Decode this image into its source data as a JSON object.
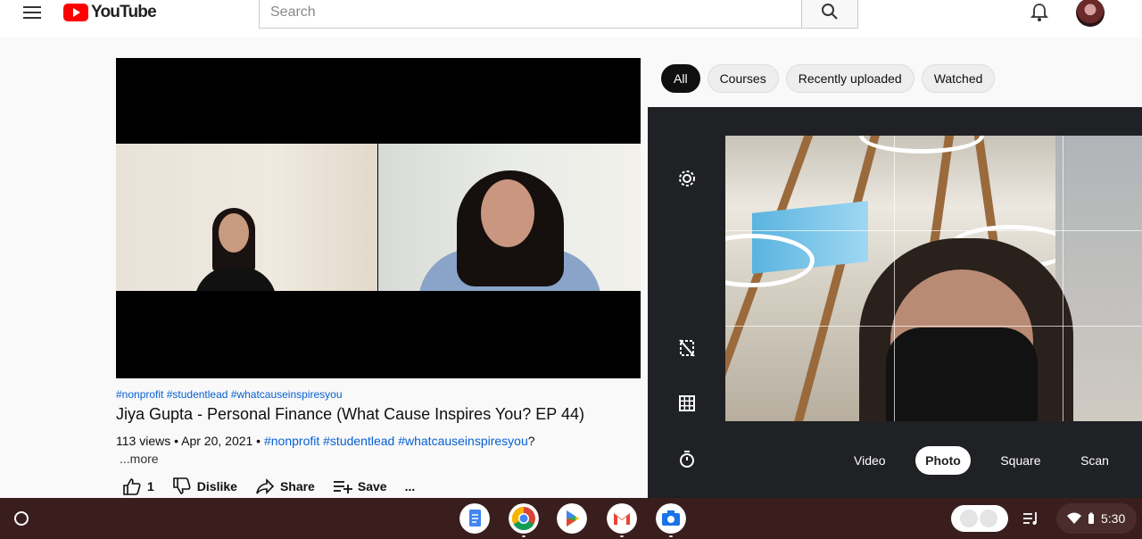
{
  "header": {
    "logo_text": "YouTube",
    "search_placeholder": "Search"
  },
  "video": {
    "tags": "#nonprofit #studentlead #whatcauseinspiresyou",
    "title": "Jiya Gupta - Personal Finance (What Cause Inspires You? EP 44)",
    "meta_prefix": "113 views • Apr 20, 2021 • ",
    "meta_hashtags": "#nonprofit #studentlead #whatcauseinspiresyou",
    "meta_suffix": "?",
    "more": "...more",
    "like_count": "1",
    "dislike_label": "Dislike",
    "share_label": "Share",
    "save_label": "Save",
    "more_actions": "..."
  },
  "chips": [
    {
      "label": "All",
      "active": true
    },
    {
      "label": "Courses",
      "active": false
    },
    {
      "label": "Recently uploaded",
      "active": false
    },
    {
      "label": "Watched",
      "active": false
    }
  ],
  "camera": {
    "modes": [
      "Video",
      "Photo",
      "Square",
      "Scan"
    ],
    "active_mode": "Photo"
  },
  "shelf": {
    "apps": [
      "Google Docs",
      "Chrome",
      "Play Store",
      "Gmail",
      "Camera"
    ],
    "time": "5:30"
  },
  "colors": {
    "link": "#065fd4",
    "youtube_red": "#ff0000",
    "camera_bg": "#202124",
    "shelf_bg": "#3a1e1e"
  }
}
